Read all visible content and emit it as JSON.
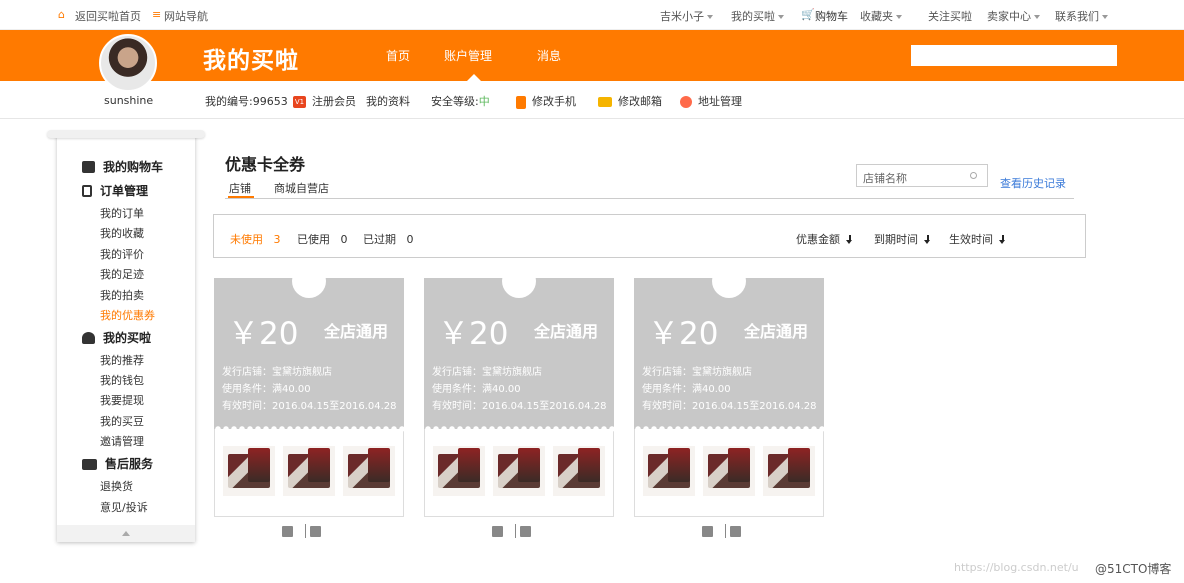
{
  "topbar": {
    "back_home": "返回买啦首页",
    "site_nav": "网站导航",
    "user": "吉米小子",
    "my_maila": "我的买啦",
    "cart": "购物车",
    "favorites": "收藏夹",
    "follow": "关注买啦",
    "seller_center": "卖家中心",
    "contact": "联系我们"
  },
  "header": {
    "brand": "我的买啦",
    "nav": [
      "首页",
      "账户管理",
      "消息"
    ],
    "active_nav": "账户管理",
    "search_placeholder": ""
  },
  "profile": {
    "username": "sunshine",
    "user_id": "我的编号:99653",
    "badge": "V1",
    "register": "注册会员",
    "my_info": "我的资料",
    "security_label": "安全等级:",
    "security_level": "中",
    "change_phone": "修改手机",
    "change_email": "修改邮箱",
    "address": "地址管理"
  },
  "sidebar": {
    "sections": [
      {
        "title": "我的购物车",
        "icon": "cart-icon",
        "items": []
      },
      {
        "title": "订单管理",
        "icon": "document-icon",
        "items": [
          "我的订单",
          "我的收藏",
          "我的评价",
          "我的足迹",
          "我的拍卖",
          "我的优惠券"
        ]
      },
      {
        "title": "我的买啦",
        "icon": "user-icon",
        "items": [
          "我的推荐",
          "我的钱包",
          "我要提现",
          "我的买豆",
          "邀请管理"
        ]
      },
      {
        "title": "售后服务",
        "icon": "idcard-icon",
        "items": [
          "退换货",
          "意见/投诉"
        ]
      }
    ],
    "active_item": "我的优惠券"
  },
  "main": {
    "title": "优惠卡全券",
    "tabs": [
      "店铺",
      "商城自营店"
    ],
    "active_tab": "店铺",
    "search_placeholder": "店铺名称",
    "history_link": "查看历史记录",
    "filters": [
      {
        "label": "未使用",
        "count": "3"
      },
      {
        "label": "已使用",
        "count": "0"
      },
      {
        "label": "已过期",
        "count": "0"
      }
    ],
    "sorts": [
      "优惠金额",
      "到期时间",
      "生效时间"
    ]
  },
  "coupons": [
    {
      "value": "￥20",
      "scope": "全店通用",
      "shop": "发行店铺：宝黛坊旗舰店",
      "condition": "使用条件：满40.00",
      "period": "有效时间：2016.04.15至2016.04.28"
    },
    {
      "value": "￥20",
      "scope": "全店通用",
      "shop": "发行店铺：宝黛坊旗舰店",
      "condition": "使用条件：满40.00",
      "period": "有效时间：2016.04.15至2016.04.28"
    },
    {
      "value": "￥20",
      "scope": "全店通用",
      "shop": "发行店铺：宝黛坊旗舰店",
      "condition": "使用条件：满40.00",
      "period": "有效时间：2016.04.15至2016.04.28"
    }
  ],
  "watermark": {
    "url": "https://blog.csdn.net/u",
    "brand": "@51CTO博客"
  },
  "colors": {
    "accent": "#ff7a00",
    "link": "#3a7ad8",
    "coupon_gray": "#c8c8c8"
  }
}
